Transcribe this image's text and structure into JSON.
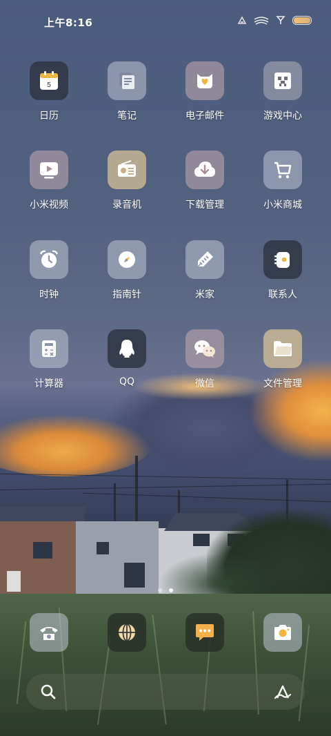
{
  "status_bar": {
    "time": "上午8:16",
    "icons": [
      "data-icon",
      "wifi-icon",
      "signal-icon",
      "battery-icon"
    ]
  },
  "apps": [
    {
      "label": "日历",
      "icon": "calendar-icon",
      "calendar_day": "5"
    },
    {
      "label": "笔记",
      "icon": "notes-icon"
    },
    {
      "label": "电子邮件",
      "icon": "email-icon"
    },
    {
      "label": "游戏中心",
      "icon": "game-center-icon"
    },
    {
      "label": "小米视频",
      "icon": "video-icon"
    },
    {
      "label": "录音机",
      "icon": "recorder-icon"
    },
    {
      "label": "下载管理",
      "icon": "download-icon"
    },
    {
      "label": "小米商城",
      "icon": "shopping-cart-icon"
    },
    {
      "label": "时钟",
      "icon": "clock-icon"
    },
    {
      "label": "指南针",
      "icon": "compass-icon"
    },
    {
      "label": "米家",
      "icon": "mijia-icon"
    },
    {
      "label": "联系人",
      "icon": "contacts-icon"
    },
    {
      "label": "计算器",
      "icon": "calculator-icon"
    },
    {
      "label": "QQ",
      "icon": "qq-icon"
    },
    {
      "label": "微信",
      "icon": "wechat-icon"
    },
    {
      "label": "文件管理",
      "icon": "file-manager-icon"
    }
  ],
  "page_indicator": {
    "pages": 2,
    "current": 2
  },
  "dock": [
    {
      "icon": "phone-icon"
    },
    {
      "icon": "browser-icon"
    },
    {
      "icon": "messages-icon"
    },
    {
      "icon": "camera-icon"
    }
  ],
  "search_bar": {
    "icons": [
      "search-icon",
      "assistant-icon"
    ]
  },
  "colors": {
    "accent_orange": "#f5a93a",
    "tile_dark": "#323848",
    "text": "#ffffff"
  }
}
